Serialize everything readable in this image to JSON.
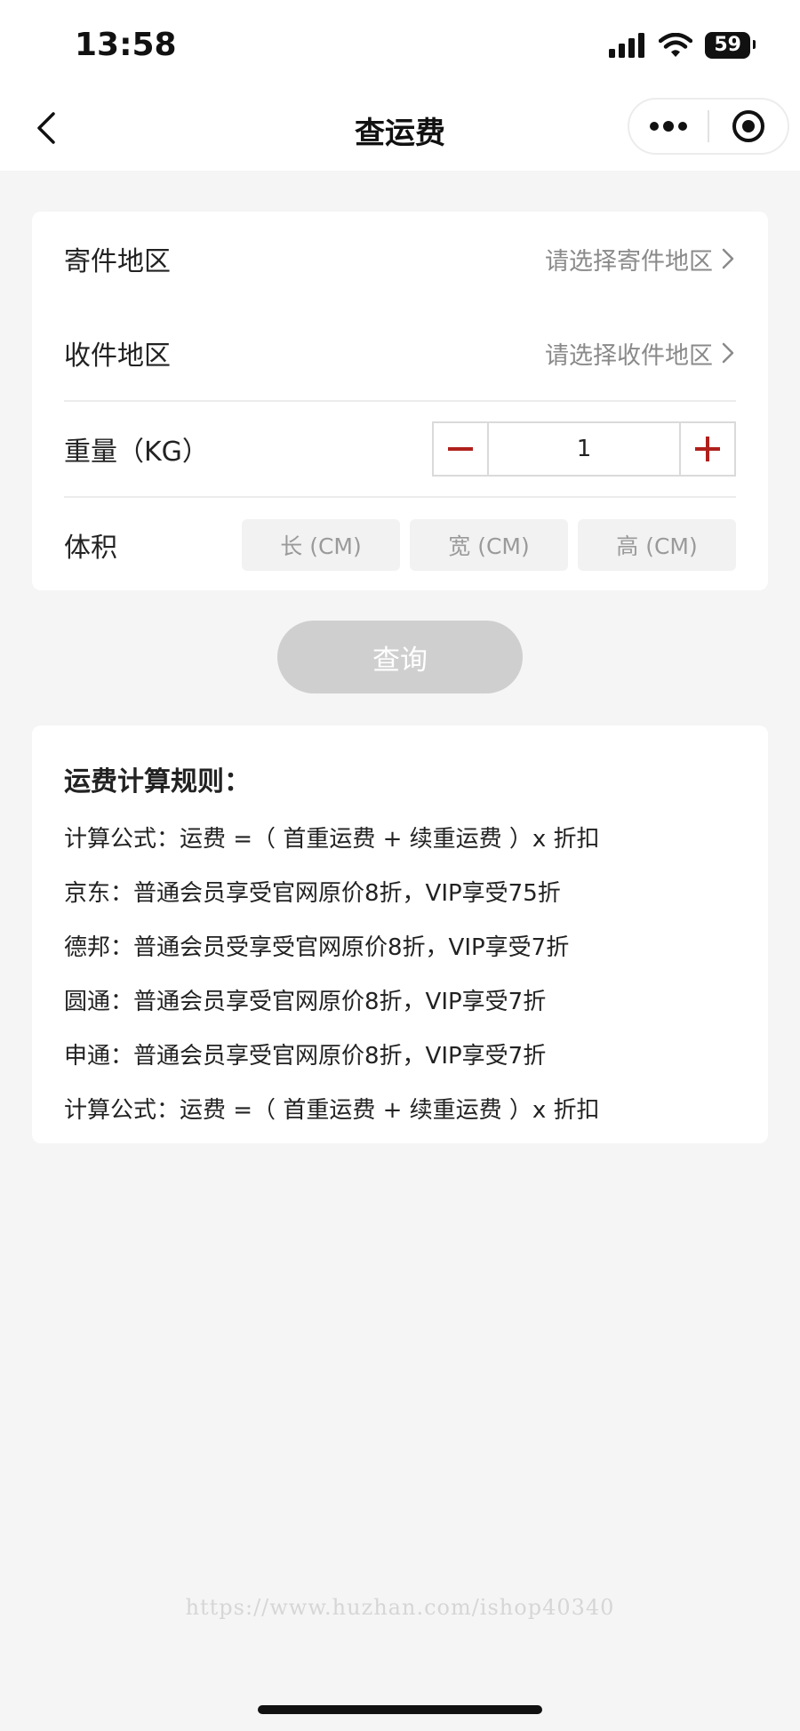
{
  "status_bar": {
    "time": "13:58",
    "battery": "59"
  },
  "nav": {
    "title": "查运费"
  },
  "form": {
    "origin": {
      "label": "寄件地区",
      "placeholder": "请选择寄件地区"
    },
    "destination": {
      "label": "收件地区",
      "placeholder": "请选择收件地区"
    },
    "weight": {
      "label": "重量（KG）",
      "value": "1"
    },
    "volume": {
      "label": "体积",
      "length_placeholder": "长 (CM)",
      "width_placeholder": "宽 (CM)",
      "height_placeholder": "高 (CM)"
    }
  },
  "query_button": {
    "label": "查询"
  },
  "rules": {
    "title": "运费计算规则：",
    "lines": [
      "计算公式：运费 =（ 首重运费 + 续重运费 ）x 折扣",
      "京东：普通会员享受官网原价8折，VIP享受75折",
      "德邦：普通会员受享受官网原价8折，VIP享受7折",
      "圆通：普通会员享受官网原价8折，VIP享受7折",
      "申通：普通会员享受官网原价8折，VIP享受7折",
      "计算公式：运费 =（ 首重运费 + 续重运费 ）x 折扣"
    ]
  },
  "watermark": "https://www.huzhan.com/ishop40340",
  "colors": {
    "accent": "#b0201b",
    "disabled_button": "#cfcfcf",
    "page_bg": "#f5f5f5"
  }
}
